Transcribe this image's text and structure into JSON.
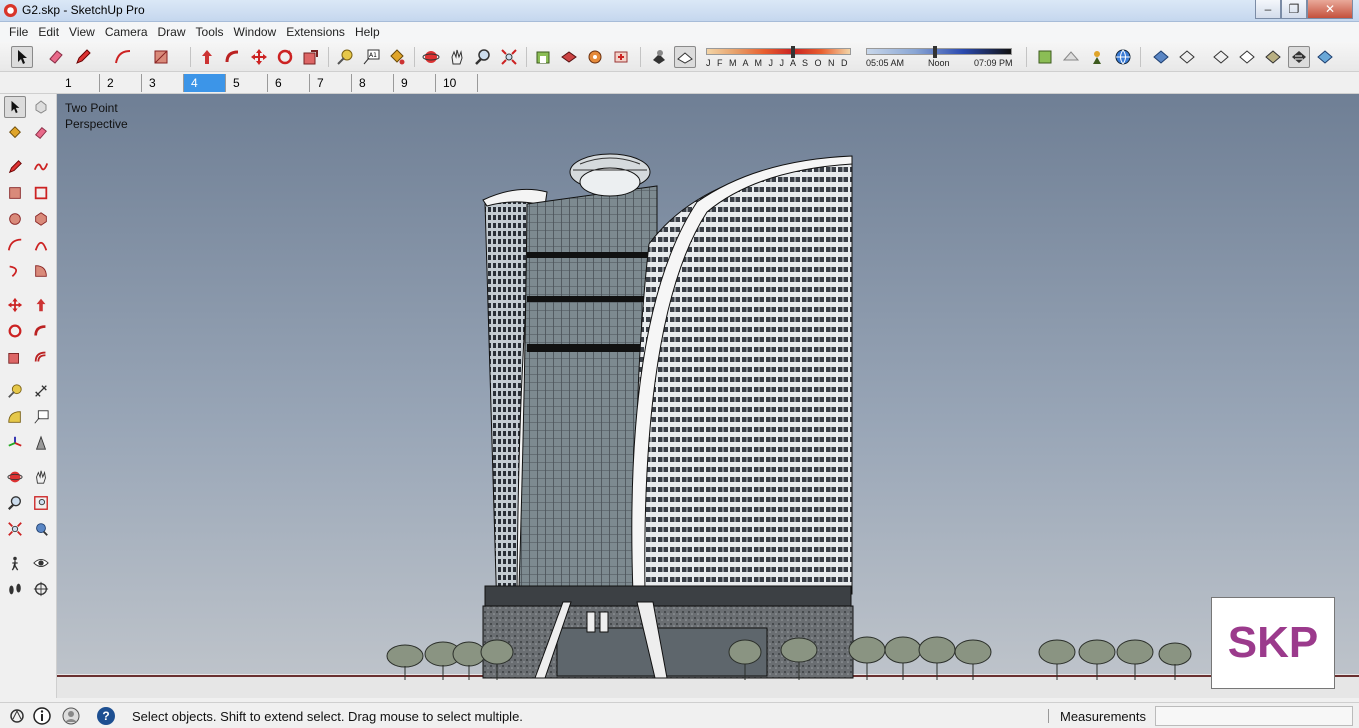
{
  "window": {
    "title": "G2.skp - SketchUp Pro",
    "minimize_glyph": "–",
    "restore_glyph": "❐",
    "close_glyph": "✕"
  },
  "menu": [
    "File",
    "Edit",
    "View",
    "Camera",
    "Draw",
    "Tools",
    "Window",
    "Extensions",
    "Help"
  ],
  "shadow": {
    "months": "J F M A M J J A S O N D",
    "time_start": "05:05 AM",
    "time_mid": "Noon",
    "time_end": "07:09 PM"
  },
  "scenes": [
    "1",
    "2",
    "3",
    "4",
    "5",
    "6",
    "7",
    "8",
    "9",
    "10"
  ],
  "active_scene": "4",
  "viewport": {
    "label_line1": "Two Point",
    "label_line2": "Perspective",
    "badge": "SKP"
  },
  "status": {
    "message": "Select objects. Shift to extend select. Drag mouse to select multiple.",
    "measurements_label": "Measurements",
    "measurements_value": ""
  },
  "toolbar_icons": [
    "select-icon",
    "eraser-icon",
    "pencil-icon",
    "arc-icon",
    "rectangle-icon",
    "push-pull-icon",
    "follow-me-icon",
    "move-icon",
    "rotate-icon",
    "scale-icon",
    "tape-measure-icon",
    "text-icon",
    "paint-bucket-icon",
    "orbit-icon",
    "pan-icon",
    "zoom-icon",
    "zoom-extents-icon",
    "warehouse-icon",
    "share-model-icon",
    "components-icon",
    "extension-icon",
    "shadows-icon",
    "fog-icon",
    "styles-icon"
  ],
  "colors": {
    "viewport_sky_top": "#6f7f95",
    "viewport_sky_bottom": "#c1c6cc",
    "active_scene": "#3c95e8",
    "skp_badge_text": "#9b3a8c"
  }
}
